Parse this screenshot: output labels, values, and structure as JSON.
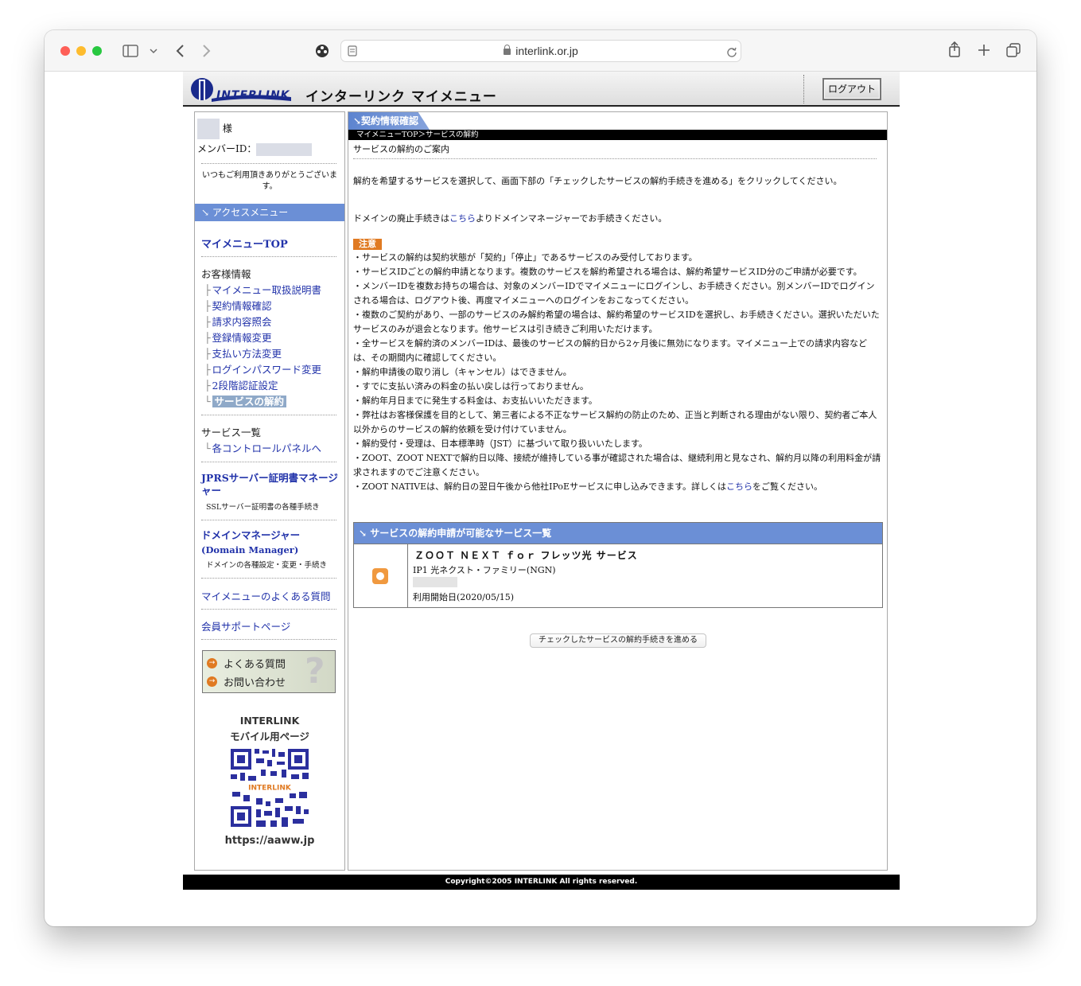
{
  "browser": {
    "url": "interlink.or.jp",
    "icons": [
      "sidebar-icon",
      "chevron-down-icon",
      "back-icon",
      "forward-icon",
      "extension-icon",
      "reader-icon",
      "lock-icon",
      "reload-icon",
      "share-icon",
      "new-tab-icon",
      "tabs-icon"
    ]
  },
  "header": {
    "site_title": "インターリンク マイメニュー",
    "logout_label": "ログアウト"
  },
  "sidebar": {
    "user_suffix": "様",
    "member_id_label": "メンバーID：",
    "thanks": "いつもご利用頂きありがとうございます。",
    "access_menu": "↘ アクセスメニュー",
    "mymenu_top": "マイメニューTOP",
    "customer_info": "お客様情報",
    "customer_items": [
      {
        "label": "マイメニュー取扱説明書",
        "branch": "├"
      },
      {
        "label": "契約情報確認",
        "branch": "├"
      },
      {
        "label": "請求内容照会",
        "branch": "├"
      },
      {
        "label": "登録情報変更",
        "branch": "├"
      },
      {
        "label": "支払い方法変更",
        "branch": "├"
      },
      {
        "label": "ログインパスワード変更",
        "branch": "├"
      },
      {
        "label": "2段階認証設定",
        "branch": "├"
      },
      {
        "label": "サービスの解約",
        "branch": "└"
      }
    ],
    "service_list": "サービス一覧",
    "control_panel": "各コントロールパネルへ",
    "control_branch": "└",
    "jprs_title": "JPRSサーバー証明書マネージャー",
    "jprs_note": "SSLサーバー証明書の各種手続き",
    "domain_title": "ドメインマネージャー",
    "domain_sub": "(Domain Manager)",
    "domain_note": "ドメインの各種設定・変更・手続き",
    "mymenu_faq": "マイメニューのよくある質問",
    "support_page": "会員サポートページ",
    "faq_box": {
      "faq": "よくある質問",
      "contact": "お問い合わせ",
      "arrow": "→",
      "mark": "?"
    },
    "mobile_title_1": "INTERLINK",
    "mobile_title_2": "モバイル用ページ",
    "qr_label": "INTERLINK",
    "mobile_url": "https://aaww.jp"
  },
  "main": {
    "tab_label": "↘契約情報確認",
    "breadcrumb": "マイメニューTOP＞サービスの解約",
    "heading": "サービスの解約のご案内",
    "intro": "解約を希望するサービスを選択して、画面下部の「チェックしたサービスの解約手続きを進める」をクリックしてください。",
    "domain_pre": "ドメインの廃止手続きは",
    "domain_link": "こちら",
    "domain_post": "よりドメインマネージャーでお手続きください。",
    "caution_label": "注意",
    "notes": [
      "・サービスの解約は契約状態が「契約」「停止」であるサービスのみ受付しております。",
      "・サービスIDごとの解約申請となります。複数のサービスを解約希望される場合は、解約希望サービスID分のご申請が必要です。",
      "・メンバーIDを複数お持ちの場合は、対象のメンバーIDでマイメニューにログインし、お手続きください。別メンバーIDでログインされる場合は、ログアウト後、再度マイメニューへのログインをおこなってください。",
      "・複数のご契約があり、一部のサービスのみ解約希望の場合は、解約希望のサービスIDを選択し、お手続きください。選択いただいたサービスのみが退会となります。他サービスは引き続きご利用いただけます。",
      "・全サービスを解約済のメンバーIDは、最後のサービスの解約日から2ヶ月後に無効になります。マイメニュー上での請求内容などは、その期間内に確認してください。",
      "・解約申請後の取り消し（キャンセル）はできません。",
      "・すでに支払い済みの料金の払い戻しは行っておりません。",
      "・解約年月日までに発生する料金は、お支払いいただきます。",
      "・弊社はお客様保護を目的として、第三者による不正なサービス解約の防止のため、正当と判断される理由がない限り、契約者ご本人以外からのサービスの解約依頼を受け付けていません。",
      "・解約受付・受理は、日本標準時（JST）に基づいて取り扱いいたします。",
      "・ZOOT、ZOOT NEXTで解約日以降、接続が維持している事が確認された場合は、継続利用と見なされ、解約月以降の利用料金が請求されますのでご注意ください。"
    ],
    "last_note_pre": "・ZOOT NATIVEは、解約日の翌日午後から他社IPoEサービスに申し込みできます。詳しくは",
    "last_note_link": "こちら",
    "last_note_post": "をご覧ください。",
    "service_table_title": "↘ サービスの解約申請が可能なサービス一覧",
    "service": {
      "name": "ＺＯＯＴ ＮＥＸＴ ｆｏｒ フレッツ光 サービス",
      "plan": "IP1 光ネクスト・ファミリー(NGN)",
      "start": "利用開始日(2020/05/15)",
      "checked": true
    },
    "submit_label": "チェックしたサービスの解約手続きを進める"
  },
  "footer": {
    "copyright": "Copyright©2005 INTERLINK All rights reserved."
  }
}
